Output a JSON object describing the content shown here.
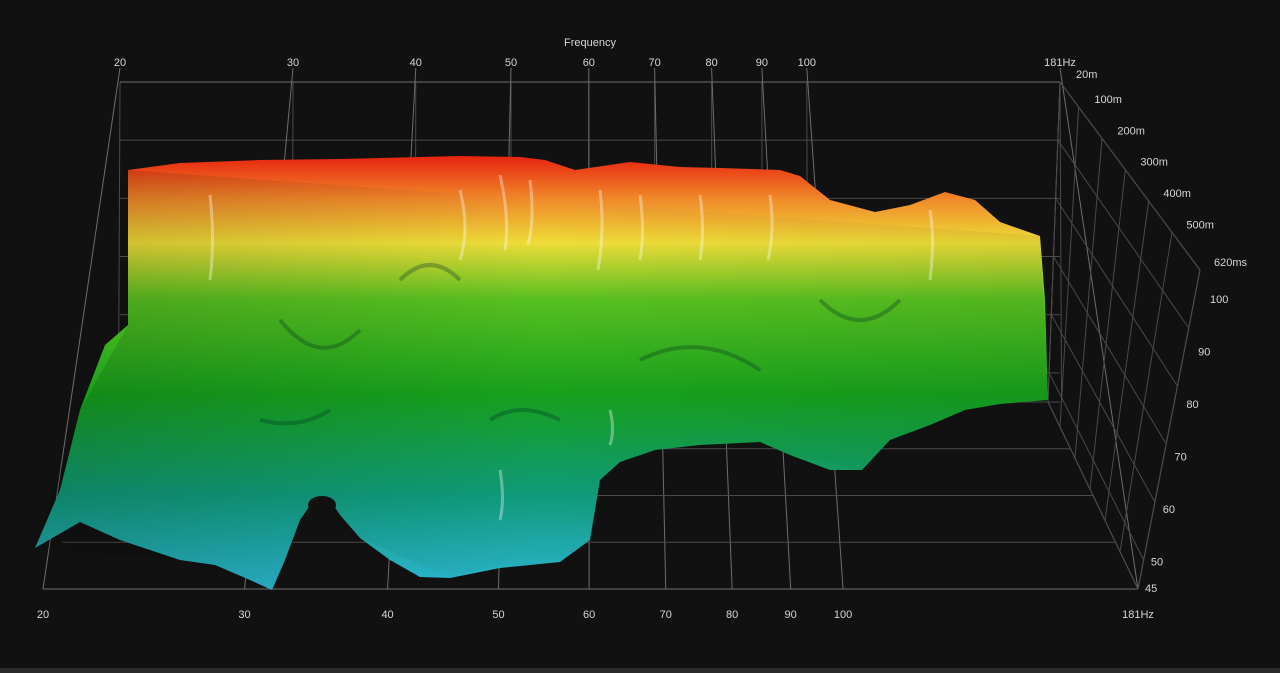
{
  "chart_data": {
    "type": "waterfall-3d",
    "title": "Frequency",
    "x_axis": {
      "scale": "log",
      "range": [
        20,
        181
      ],
      "ticks_top": [
        "20",
        "30",
        "40",
        "50",
        "60",
        "70",
        "80",
        "90",
        "100",
        "181Hz"
      ],
      "ticks_bottom": [
        "20",
        "30",
        "40",
        "50",
        "60",
        "70",
        "80",
        "90",
        "100",
        "181Hz"
      ],
      "tick_values": [
        20,
        30,
        40,
        50,
        60,
        70,
        80,
        90,
        100,
        181
      ]
    },
    "time_axis": {
      "ticks": [
        "20m",
        "100m",
        "200m",
        "300m",
        "400m",
        "500m",
        "620ms"
      ],
      "tick_values": [
        20,
        100,
        200,
        300,
        400,
        500,
        620
      ]
    },
    "level_axis": {
      "ticks": [
        "100",
        "90",
        "80",
        "70",
        "60",
        "50",
        "45"
      ],
      "tick_values": [
        100,
        90,
        80,
        70,
        60,
        50,
        45
      ],
      "range": [
        45,
        100
      ]
    },
    "colors": {
      "background": "#111111",
      "high": "#e8230f",
      "mid_high": "#f0e030",
      "mid": "#1fa81f",
      "low": "#2ab8d0"
    }
  }
}
